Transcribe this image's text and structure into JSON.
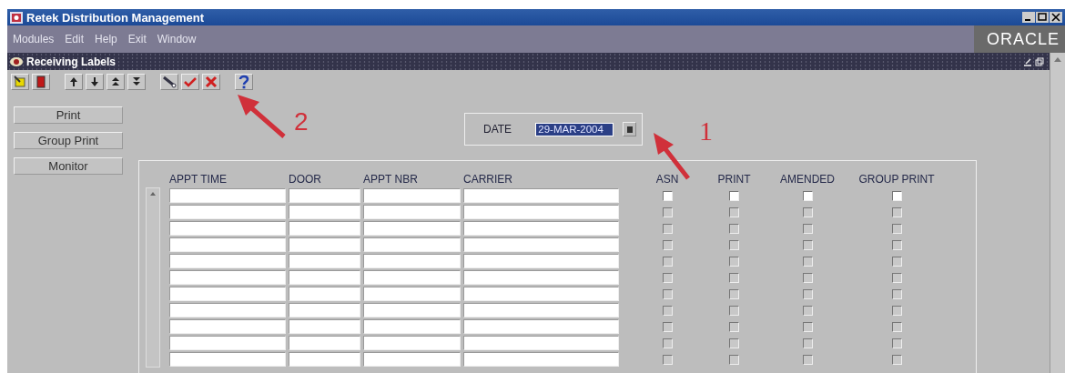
{
  "window": {
    "title": "Retek Distribution Management"
  },
  "menu": [
    "Modules",
    "Edit",
    "Help",
    "Exit",
    "Window"
  ],
  "logo": "ORACLE",
  "form": {
    "title": "Receiving Labels"
  },
  "side_buttons": [
    "Print",
    "Group Print",
    "Monitor"
  ],
  "date": {
    "label": "DATE",
    "value": "29-MAR-2004",
    "selected": true
  },
  "table": {
    "columns": [
      {
        "label": "APPT TIME",
        "kind": "text"
      },
      {
        "label": "DOOR",
        "kind": "text"
      },
      {
        "label": "APPT NBR",
        "kind": "text"
      },
      {
        "label": "CARRIER",
        "kind": "text"
      },
      {
        "label": "ASN",
        "kind": "checkbox"
      },
      {
        "label": "PRINT",
        "kind": "checkbox"
      },
      {
        "label": "AMENDED",
        "kind": "checkbox"
      },
      {
        "label": "GROUP PRINT",
        "kind": "checkbox"
      }
    ],
    "rows": [
      {
        "disabled": false,
        "checked": [
          false,
          false,
          false,
          false
        ]
      },
      {
        "disabled": true,
        "checked": [
          false,
          false,
          false,
          false
        ]
      },
      {
        "disabled": true,
        "checked": [
          false,
          false,
          false,
          false
        ]
      },
      {
        "disabled": true,
        "checked": [
          false,
          false,
          false,
          false
        ]
      },
      {
        "disabled": true,
        "checked": [
          false,
          false,
          false,
          false
        ]
      },
      {
        "disabled": true,
        "checked": [
          false,
          false,
          false,
          false
        ]
      },
      {
        "disabled": true,
        "checked": [
          false,
          false,
          false,
          false
        ]
      },
      {
        "disabled": true,
        "checked": [
          false,
          false,
          false,
          false
        ]
      },
      {
        "disabled": true,
        "checked": [
          false,
          false,
          false,
          false
        ]
      },
      {
        "disabled": true,
        "checked": [
          false,
          false,
          false,
          false
        ]
      },
      {
        "disabled": true,
        "checked": [
          false,
          false,
          false,
          false
        ]
      }
    ]
  },
  "annotations": [
    {
      "label": "2"
    },
    {
      "label": "1"
    }
  ]
}
